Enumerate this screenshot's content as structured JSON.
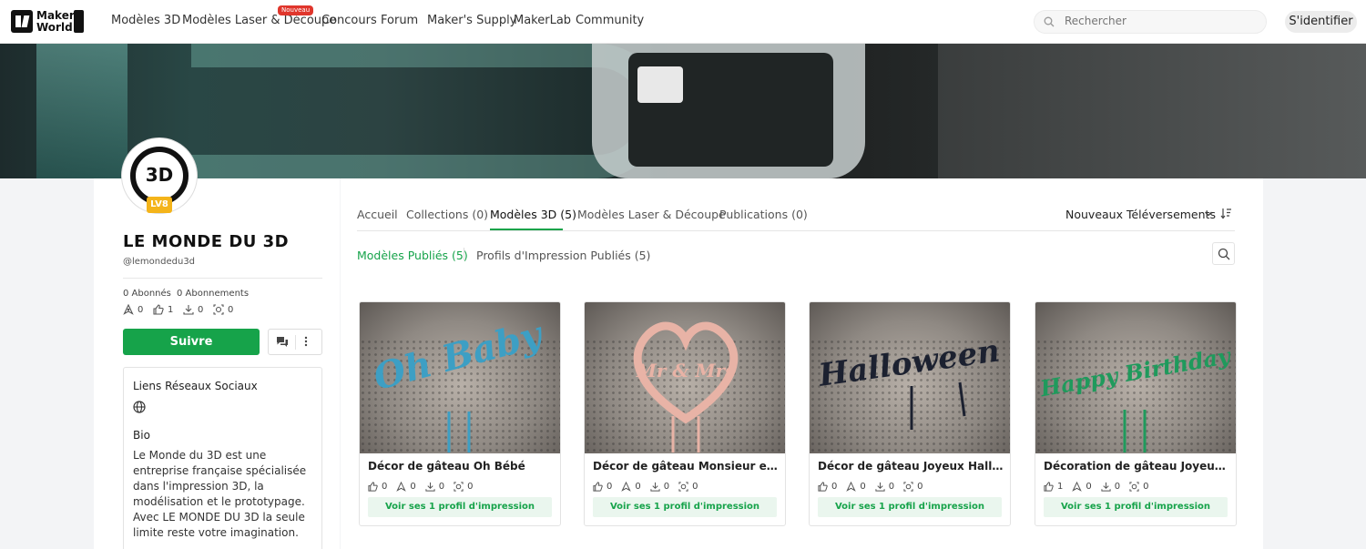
{
  "nav": {
    "logo_line1": "Maker",
    "logo_line2": "World",
    "items": [
      "Modèles 3D",
      "Modèles Laser & Découpe",
      "Concours",
      "Forum",
      "Maker's Supply",
      "MakerLab",
      "Community"
    ],
    "new_badge": "Nouveau",
    "search_placeholder": "Rechercher",
    "signin": "S'identifier"
  },
  "profile": {
    "avatar_text": "3D",
    "level_badge": "LV8",
    "name": "LE MONDE DU 3D",
    "handle": "@lemondedu3d",
    "followers": "0 Abonnés",
    "following": "0 Abonnements",
    "stat_boosts": "0",
    "stat_likes": "1",
    "stat_downloads": "0",
    "stat_prints": "0",
    "follow_button": "Suivre",
    "social_title": "Liens Réseaux Sociaux",
    "bio_label": "Bio",
    "bio_text": "Le Monde du 3D est une entreprise française spécialisée dans l'impression 3D, la modélisation et le prototypage.\nAvec LE MONDE DU 3D la seule limite reste votre imagination."
  },
  "tabs": [
    {
      "label": "Accueil"
    },
    {
      "label": "Collections (0)"
    },
    {
      "label": "Modèles 3D (5)"
    },
    {
      "label": "Modèles Laser & Découpe"
    },
    {
      "label": "Publications (0)"
    }
  ],
  "sort_label": "Nouveaux Téléversements",
  "subtabs": {
    "published": "Modèles Publiés (5)",
    "profiles": "Profils d'Impression Publiés (5)"
  },
  "cards": [
    {
      "title": "Décor de gâteau Oh Bébé",
      "likes": "0",
      "boosts": "0",
      "downloads": "0",
      "prints": "0",
      "button": "Voir ses 1 profil d'impression",
      "topper_text": "Oh Baby",
      "color": "#3d9fc4"
    },
    {
      "title": "Décor de gâteau Monsieur et Mad...",
      "likes": "0",
      "boosts": "0",
      "downloads": "0",
      "prints": "0",
      "button": "Voir ses 1 profil d'impression",
      "topper_text": "Mr & Mrs",
      "color": "#e8b3a6"
    },
    {
      "title": "Décor de gâteau Joyeux Halloween",
      "likes": "0",
      "boosts": "0",
      "downloads": "0",
      "prints": "0",
      "button": "Voir ses 1 profil d'impression",
      "topper_text": "Halloween",
      "color": "#1c2130"
    },
    {
      "title": "Décoration de gâteau Joyeux Anni...",
      "likes": "1",
      "boosts": "0",
      "downloads": "0",
      "prints": "0",
      "button": "Voir ses 1 profil d'impression",
      "topper_text": "Happy Birthday",
      "color": "#1f9a5c"
    }
  ]
}
